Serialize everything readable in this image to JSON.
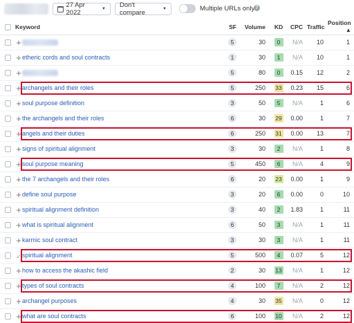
{
  "toolbar": {
    "date_label": "27 Apr 2022",
    "compare_label": "Don't compare",
    "multiple_urls_label": "Multiple URLs only",
    "multiple_urls_on": false
  },
  "columns": {
    "keyword": "Keyword",
    "sf": "SF",
    "volume": "Volume",
    "kd": "KD",
    "cpc": "CPC",
    "traffic": "Traffic",
    "position": "Position ▴"
  },
  "kd_colors": {
    "low": "#a6dcb0",
    "mid": "#d9ec9c",
    "medium": "#efe6a1"
  },
  "highlight_color": "#c8102e",
  "rows": [
    {
      "keyword": "",
      "blurred": true,
      "action": "plus",
      "sf": "5",
      "volume": "30",
      "kd": "0",
      "kd_level": "low",
      "cpc": "N/A",
      "traffic": "10",
      "position": "1",
      "highlighted": false
    },
    {
      "keyword": "etheric cords and soul contracts",
      "blurred": false,
      "action": "plus",
      "sf": "1",
      "volume": "30",
      "kd": "1",
      "kd_level": "low",
      "cpc": "N/A",
      "traffic": "10",
      "position": "1",
      "highlighted": false
    },
    {
      "keyword": "",
      "blurred": true,
      "action": "plus",
      "sf": "5",
      "volume": "80",
      "kd": "0",
      "kd_level": "low",
      "cpc": "0.15",
      "traffic": "12",
      "position": "2",
      "highlighted": false
    },
    {
      "keyword": "archangels and their roles",
      "blurred": false,
      "action": "plus",
      "sf": "5",
      "volume": "250",
      "kd": "33",
      "kd_level": "medium",
      "cpc": "0.23",
      "traffic": "15",
      "position": "6",
      "highlighted": true
    },
    {
      "keyword": "soul purpose definition",
      "blurred": false,
      "action": "plus",
      "sf": "3",
      "volume": "50",
      "kd": "5",
      "kd_level": "low",
      "cpc": "N/A",
      "traffic": "1",
      "position": "6",
      "highlighted": false
    },
    {
      "keyword": "the archangels and their roles",
      "blurred": false,
      "action": "plus",
      "sf": "6",
      "volume": "30",
      "kd": "29",
      "kd_level": "medium",
      "cpc": "0.00",
      "traffic": "1",
      "position": "7",
      "highlighted": false
    },
    {
      "keyword": "angels and their duties",
      "blurred": false,
      "action": "plus",
      "sf": "6",
      "volume": "250",
      "kd": "31",
      "kd_level": "medium",
      "cpc": "0.00",
      "traffic": "13",
      "position": "7",
      "highlighted": true
    },
    {
      "keyword": "signs of spiritual alignment",
      "blurred": false,
      "action": "plus",
      "sf": "3",
      "volume": "30",
      "kd": "2",
      "kd_level": "low",
      "cpc": "N/A",
      "traffic": "1",
      "position": "8",
      "highlighted": false
    },
    {
      "keyword": "soul purpose meaning",
      "blurred": false,
      "action": "plus",
      "sf": "5",
      "volume": "450",
      "kd": "6",
      "kd_level": "low",
      "cpc": "N/A",
      "traffic": "4",
      "position": "9",
      "highlighted": true
    },
    {
      "keyword": "the 7 archangels and their roles",
      "blurred": false,
      "action": "plus",
      "sf": "6",
      "volume": "20",
      "kd": "23",
      "kd_level": "mid",
      "cpc": "0.00",
      "traffic": "1",
      "position": "9",
      "highlighted": false
    },
    {
      "keyword": "define soul purpose",
      "blurred": false,
      "action": "plus",
      "sf": "3",
      "volume": "20",
      "kd": "6",
      "kd_level": "low",
      "cpc": "0.00",
      "traffic": "0",
      "position": "10",
      "highlighted": false
    },
    {
      "keyword": "spiritual alignment definition",
      "blurred": false,
      "action": "plus",
      "sf": "3",
      "volume": "40",
      "kd": "2",
      "kd_level": "low",
      "cpc": "1.83",
      "traffic": "1",
      "position": "11",
      "highlighted": false
    },
    {
      "keyword": "what is spiritual alignment",
      "blurred": false,
      "action": "plus",
      "sf": "6",
      "volume": "50",
      "kd": "3",
      "kd_level": "low",
      "cpc": "N/A",
      "traffic": "1",
      "position": "11",
      "highlighted": false
    },
    {
      "keyword": "karmic soul contract",
      "blurred": false,
      "action": "plus",
      "sf": "3",
      "volume": "30",
      "kd": "3",
      "kd_level": "low",
      "cpc": "N/A",
      "traffic": "1",
      "position": "11",
      "highlighted": false
    },
    {
      "keyword": "spiritual alignment",
      "blurred": false,
      "action": "check",
      "sf": "5",
      "volume": "500",
      "kd": "4",
      "kd_level": "low",
      "cpc": "0.07",
      "traffic": "5",
      "position": "12",
      "highlighted": true
    },
    {
      "keyword": "how to access the akashic field",
      "blurred": false,
      "action": "plus",
      "sf": "2",
      "volume": "30",
      "kd": "13",
      "kd_level": "low",
      "cpc": "N/A",
      "traffic": "1",
      "position": "12",
      "highlighted": false
    },
    {
      "keyword": "types of soul contracts",
      "blurred": false,
      "action": "plus",
      "sf": "4",
      "volume": "100",
      "kd": "7",
      "kd_level": "low",
      "cpc": "N/A",
      "traffic": "2",
      "position": "12",
      "highlighted": true
    },
    {
      "keyword": "archangel purposes",
      "blurred": false,
      "action": "plus",
      "sf": "4",
      "volume": "30",
      "kd": "35",
      "kd_level": "medium",
      "cpc": "N/A",
      "traffic": "0",
      "position": "12",
      "highlighted": false
    },
    {
      "keyword": "what are soul contracts",
      "blurred": false,
      "action": "plus",
      "sf": "6",
      "volume": "100",
      "kd": "10",
      "kd_level": "low",
      "cpc": "N/A",
      "traffic": "2",
      "position": "12",
      "highlighted": true
    }
  ]
}
